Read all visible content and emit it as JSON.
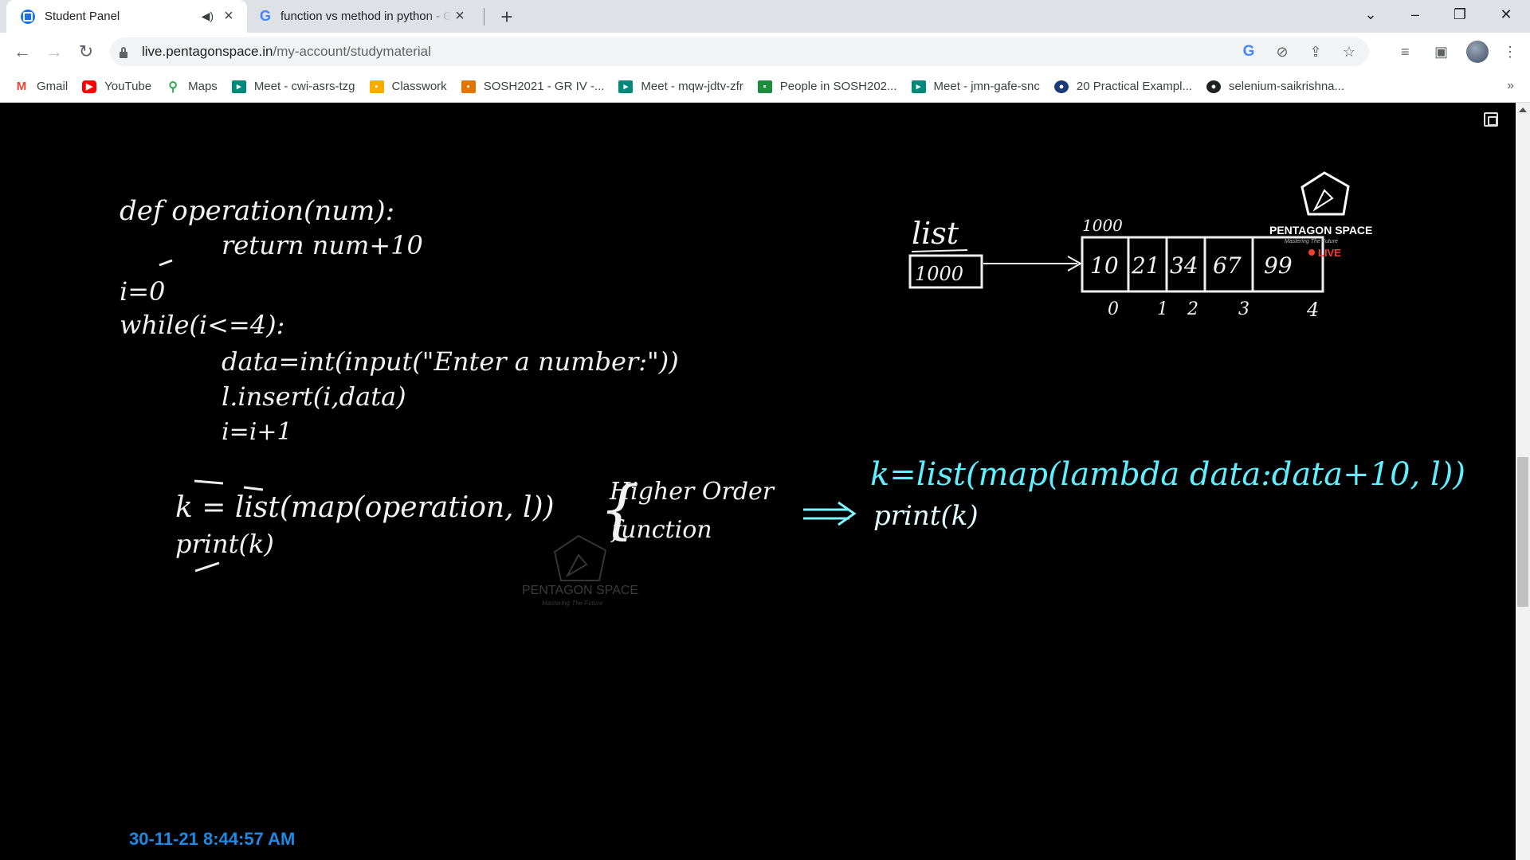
{
  "tabs": [
    {
      "title": "Student Panel",
      "favicon": "pentagon-space-icon",
      "audio": "speaker-icon",
      "active": true
    },
    {
      "title": "function vs method in python - G",
      "favicon": "google-icon",
      "active": false
    }
  ],
  "toolbar": {
    "url_host": "live.pentagonspace.in",
    "url_path": "/my-account/studymaterial"
  },
  "bookmarks": [
    {
      "label": "Gmail",
      "icon": "gmail-icon",
      "color": "#ea4335"
    },
    {
      "label": "YouTube",
      "icon": "youtube-icon",
      "color": "#ff0000"
    },
    {
      "label": "Maps",
      "icon": "maps-icon",
      "color": "#34a853"
    },
    {
      "label": "Meet - cwi-asrs-tzg",
      "icon": "meet-icon",
      "color": "#00897b"
    },
    {
      "label": "Classwork",
      "icon": "classroom-icon",
      "color": "#f9ab00"
    },
    {
      "label": "SOSH2021 - GR IV -...",
      "icon": "classroom-icon",
      "color": "#e37400"
    },
    {
      "label": "Meet - mqw-jdtv-zfr",
      "icon": "meet-icon",
      "color": "#00897b"
    },
    {
      "label": "People in SOSH202...",
      "icon": "classroom-icon",
      "color": "#1e8e3e"
    },
    {
      "label": "Meet - jmn-gafe-snc",
      "icon": "meet-icon",
      "color": "#00897b"
    },
    {
      "label": "20 Practical Exampl...",
      "icon": "site-icon",
      "color": "#1a3a7a"
    },
    {
      "label": "selenium-saikrishna...",
      "icon": "github-icon",
      "color": "#202124"
    }
  ],
  "board": {
    "code_lines": [
      "def operation(num):",
      "return num+10",
      "i=0",
      "while(i<=4):",
      "data=int(input(\"Enter a number:\"))",
      "l.insert(i,data)",
      "i=i+1",
      "k = list(map(operation, l))",
      "print(k)"
    ],
    "brace_note": [
      "Higher Order",
      "function"
    ],
    "lambda_lines": [
      "k=list(map(lambda data:data+10, l))",
      "print(k)"
    ],
    "list_label": "list",
    "list_ref": "1000",
    "list_addr": "1000",
    "list_values": [
      "10",
      "21",
      "34",
      "67",
      "99"
    ],
    "list_indexes": [
      "0",
      "1",
      "2",
      "3",
      "4"
    ],
    "logo_name": "PENTAGON SPACE",
    "logo_tagline": "Mastering The Future",
    "live_badge": "LIVE",
    "watermark_name": "PENTAGON SPACE",
    "watermark_tagline": "Mastering The Future"
  },
  "timestamp": "30-11-21 8:44:57 AM"
}
